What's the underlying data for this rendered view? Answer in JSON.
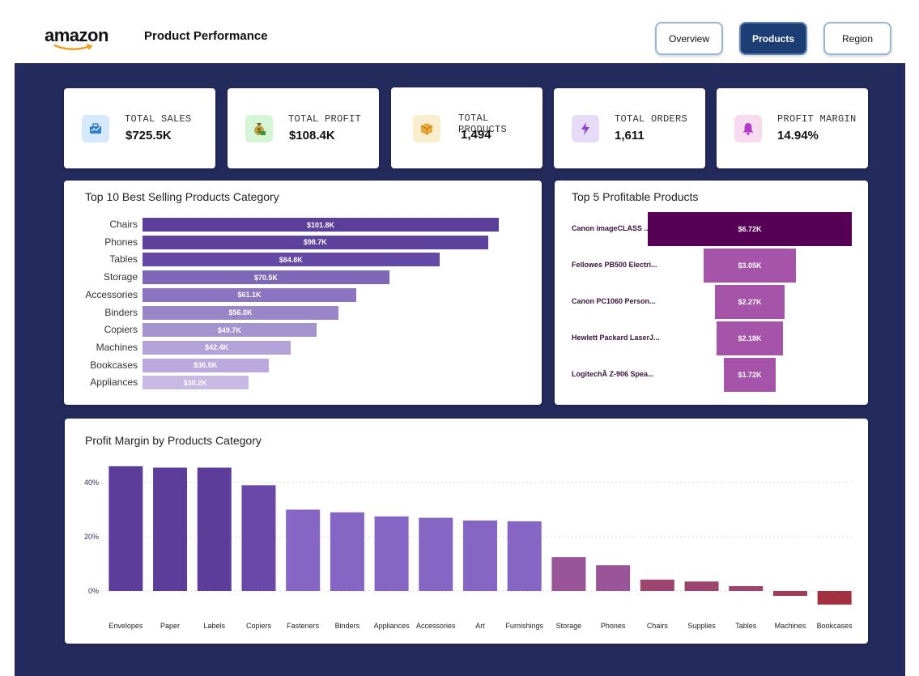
{
  "header": {
    "logo_text": "amazon",
    "title": "Product Performance",
    "nav": [
      {
        "label": "Overview",
        "active": false
      },
      {
        "label": "Products",
        "active": true
      },
      {
        "label": "Region",
        "active": false
      }
    ]
  },
  "kpis": [
    {
      "label": "TOTAL SALES",
      "value": "$725.5K",
      "icon": "briefcase-icon",
      "icon_bg": "#d6e8fb",
      "icon_color": "#2f80c8"
    },
    {
      "label": "TOTAL PROFIT",
      "value": "$108.4K",
      "icon": "money-bag-icon",
      "icon_bg": "#d4f5d6",
      "icon_color": "#3a9a3a"
    },
    {
      "label": "TOTAL PRODUCTS",
      "value": "1,494",
      "icon": "package-icon",
      "icon_bg": "#f8edcc",
      "icon_color": "#e0a030"
    },
    {
      "label": "TOTAL ORDERS",
      "value": "1,611",
      "icon": "lightning-icon",
      "icon_bg": "#e6dcf7",
      "icon_color": "#8b3fd6"
    },
    {
      "label": "PROFIT MARGIN",
      "value": "14.94%",
      "icon": "bell-icon",
      "icon_bg": "#f7dcef",
      "icon_color": "#b03cc8"
    }
  ],
  "top_selling": {
    "title": "Top 10 Best Selling Products Category",
    "chart_data": {
      "type": "bar",
      "orientation": "horizontal",
      "categories": [
        "Chairs",
        "Phones",
        "Tables",
        "Storage",
        "Accessories",
        "Binders",
        "Copiers",
        "Machines",
        "Bookcases",
        "Appliances"
      ],
      "values": [
        101.8,
        98.7,
        84.8,
        70.5,
        61.1,
        56.0,
        49.7,
        42.4,
        36.0,
        30.2
      ],
      "value_labels": [
        "$101.8K",
        "$98.7K",
        "$84.8K",
        "$70.5K",
        "$61.1K",
        "$56.0K",
        "$49.7K",
        "$42.4K",
        "$36.0K",
        "$30.2K"
      ],
      "colors": [
        "#5b3f9a",
        "#5e439e",
        "#6549a6",
        "#7f67b8",
        "#8b74c0",
        "#9886c8",
        "#a593d0",
        "#b2a2d8",
        "#bba9dd",
        "#c7b8e4"
      ]
    }
  },
  "top_profitable": {
    "title": "Top 5 Profitable Products",
    "chart_data": {
      "type": "bar",
      "orientation": "funnel",
      "categories": [
        "Canon imageCLASS ...",
        "Fellowes PB500 Electri...",
        "Canon PC1060 Person...",
        "Hewlett Packard LaserJ...",
        "LogitechÂ Z-906 Spea..."
      ],
      "values": [
        6.72,
        3.05,
        2.27,
        2.18,
        1.72
      ],
      "value_labels": [
        "$6.72K",
        "$3.05K",
        "$2.27K",
        "$2.18K",
        "$1.72K"
      ],
      "colors": [
        "#560056",
        "#a653aa",
        "#a653aa",
        "#a653aa",
        "#a653aa"
      ]
    }
  },
  "margin_by_category": {
    "title": "Profit Margin by Products Category",
    "chart_data": {
      "type": "bar",
      "categories": [
        "Envelopes",
        "Paper",
        "Labels",
        "Copiers",
        "Fasteners",
        "Binders",
        "Appliances",
        "Accessories",
        "Art",
        "Furnishings",
        "Storage",
        "Phones",
        "Chairs",
        "Supplies",
        "Tables",
        "Machines",
        "Bookcases"
      ],
      "values": [
        46,
        45.5,
        45.5,
        39,
        30,
        29,
        27.5,
        27,
        26,
        25.7,
        12.5,
        9.5,
        4.2,
        3.5,
        1.8,
        -1.8,
        -5
      ],
      "ylim": [
        -5,
        50
      ],
      "yticks": [
        0,
        20,
        40
      ],
      "ytick_labels": [
        "0%",
        "20%",
        "40%"
      ],
      "colors": [
        "#5c3d99",
        "#5c3d99",
        "#5c3d99",
        "#6a48aa",
        "#8566c4",
        "#8566c4",
        "#8566c4",
        "#8566c4",
        "#8566c4",
        "#8566c4",
        "#9a5598",
        "#9a5598",
        "#9c456f",
        "#9c456f",
        "#9c456f",
        "#a03a58",
        "#a33040"
      ]
    }
  }
}
